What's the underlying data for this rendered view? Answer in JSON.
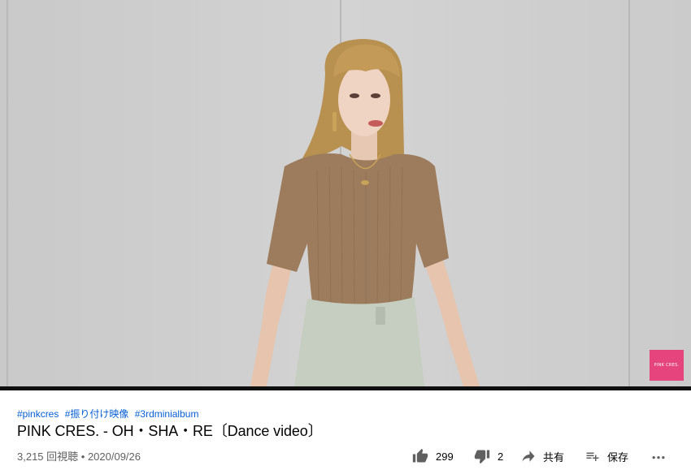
{
  "video": {
    "watermark_text": "PINK CRES."
  },
  "info": {
    "hashtags": [
      "#pinkcres",
      "#振り付け映像",
      "#3rdminialbum"
    ],
    "title": "PINK CRES. - OH・SHA・RE〔Dance video〕",
    "views": "3,215 回視聴",
    "separator": " • ",
    "date": "2020/09/26"
  },
  "actions": {
    "like_count": "299",
    "dislike_count": "2",
    "share_label": "共有",
    "save_label": "保存"
  },
  "icons": {
    "like": "thumbs-up-icon",
    "dislike": "thumbs-down-icon",
    "share": "share-arrow-icon",
    "save": "playlist-add-icon",
    "more": "more-horizontal-icon"
  },
  "colors": {
    "hashtag": "#065fd4",
    "title": "#030303",
    "meta": "#606060",
    "watermark": "#e5447c"
  }
}
